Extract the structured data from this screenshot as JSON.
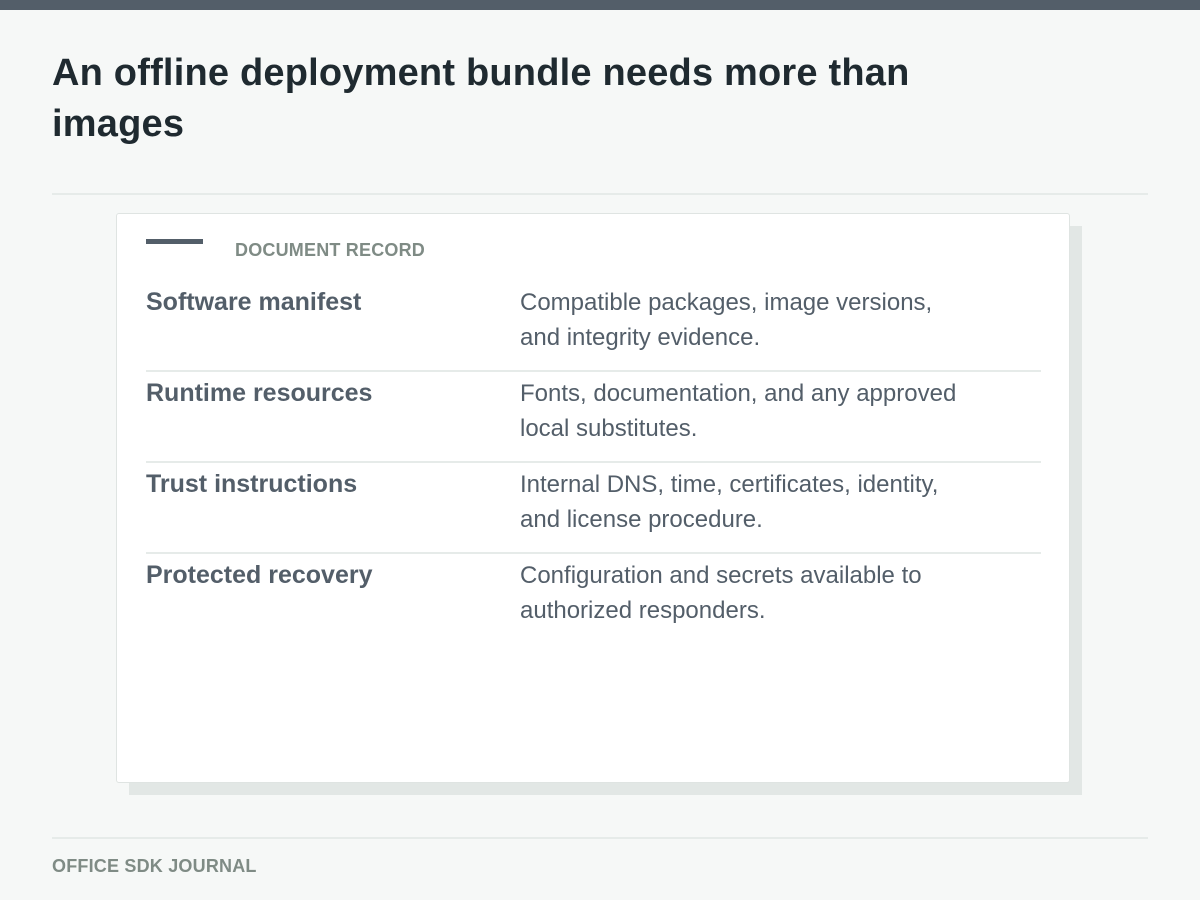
{
  "page": {
    "title": "An offline deployment bundle needs more than images",
    "footer": "OFFICE SDK JOURNAL"
  },
  "card": {
    "label": "DOCUMENT RECORD",
    "rows": [
      {
        "term": "Software manifest",
        "description": "Compatible packages, image versions, and integrity evidence."
      },
      {
        "term": "Runtime resources",
        "description": "Fonts, documentation, and any approved local substitutes."
      },
      {
        "term": "Trust instructions",
        "description": "Internal DNS, time, certificates, identity, and license procedure."
      },
      {
        "term": "Protected recovery",
        "description": "Configuration and secrets available to authorized responders."
      }
    ]
  },
  "colors": {
    "top_bar": "#535e69",
    "title": "#1f2a30",
    "label": "#7f8b85",
    "row_text": "#535e69",
    "background": "#f6f8f7"
  }
}
